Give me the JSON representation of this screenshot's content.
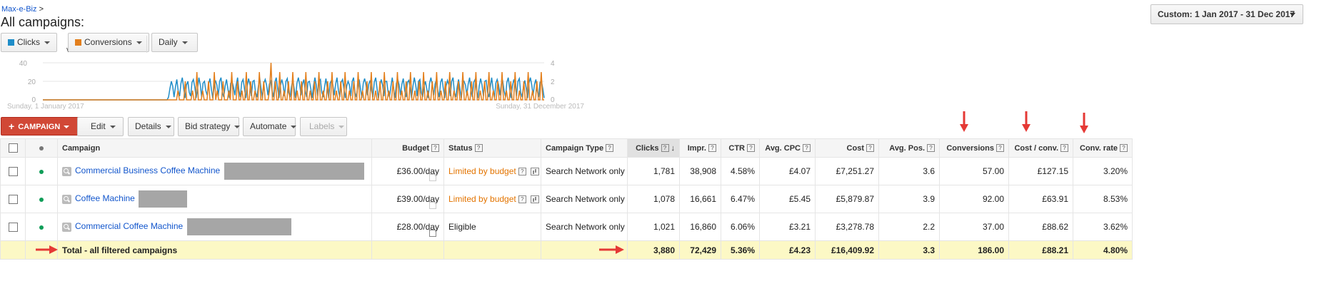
{
  "breadcrumb": {
    "account": "Max-e-Biz",
    "separator": ">"
  },
  "page_title": "All campaigns:",
  "date_range": "Custom: 1 Jan 2017 - 31 Dec 2017",
  "chart_controls": {
    "metric1": {
      "label": "Clicks",
      "color": "#1f8dc8"
    },
    "vs": "vs",
    "metric2": {
      "label": "Conversions",
      "color": "#e37f1c"
    },
    "granularity": "Daily"
  },
  "chart_data": {
    "type": "line",
    "x_start_label": "Sunday, 1 January 2017",
    "x_end_label": "Sunday, 31 December 2017",
    "left_axis": {
      "ticks": [
        "40",
        "20",
        "0"
      ],
      "ylim": [
        0,
        40
      ]
    },
    "right_axis": {
      "ticks": [
        "4",
        "2",
        "0"
      ],
      "ylim": [
        0,
        4
      ]
    },
    "series": [
      {
        "name": "Clicks",
        "color": "#1f8dc8",
        "values": [
          0,
          0,
          0,
          0,
          0,
          0,
          0,
          0,
          0,
          0,
          0,
          0,
          0,
          0,
          0,
          0,
          0,
          0,
          0,
          0,
          0,
          0,
          0,
          0,
          0,
          0,
          0,
          0,
          0,
          0,
          0,
          0,
          0,
          0,
          0,
          0,
          0,
          0,
          0,
          0,
          0,
          0,
          0,
          0,
          0,
          0,
          0,
          0,
          0,
          0,
          0,
          0,
          0,
          0,
          0,
          0,
          0,
          0,
          0,
          0,
          0,
          0,
          0,
          0,
          0,
          0,
          0,
          0,
          0,
          0,
          0,
          0,
          0,
          0,
          0,
          0,
          0,
          0,
          0,
          0,
          0,
          0,
          0,
          0,
          0,
          0,
          0,
          0,
          0,
          0,
          0,
          3,
          12,
          20,
          15,
          3,
          14,
          22,
          10,
          4,
          18,
          24,
          12,
          2,
          16,
          20,
          8,
          4,
          19,
          22,
          14,
          2,
          12,
          24,
          16,
          3,
          18,
          20,
          10,
          5,
          17,
          23,
          12,
          2,
          14,
          21,
          16,
          4,
          20,
          24,
          8,
          3,
          15,
          22,
          12,
          2,
          18,
          20,
          14,
          5,
          16,
          24,
          10,
          3,
          19,
          22,
          12,
          2,
          15,
          23,
          16,
          4,
          20,
          21,
          8,
          3,
          14,
          24,
          12,
          2,
          18,
          22,
          16,
          5,
          17,
          20,
          10,
          3,
          19,
          24,
          12,
          2,
          15,
          22,
          16,
          4,
          20,
          23,
          8,
          3,
          14,
          21,
          12,
          2,
          18,
          24,
          16,
          5,
          17,
          22,
          10,
          3,
          19,
          20,
          12,
          2,
          15,
          24,
          16,
          4,
          20,
          22,
          8,
          3,
          14,
          23,
          12,
          2,
          18,
          21,
          16,
          5,
          17,
          24,
          10,
          3,
          19,
          22,
          12,
          2,
          15,
          20,
          16,
          4,
          20,
          24,
          8,
          3,
          14,
          22,
          12,
          2,
          18,
          23,
          16,
          5,
          17,
          21,
          10,
          3,
          19,
          24,
          12,
          2,
          15,
          22,
          16,
          4,
          20,
          20,
          8,
          3,
          14,
          24,
          12,
          2,
          18,
          22,
          16,
          5,
          17,
          23,
          10,
          3,
          19,
          21,
          12,
          2,
          15,
          24,
          16,
          4,
          20,
          22,
          8,
          3,
          14,
          20,
          12,
          2,
          18,
          24,
          16,
          5,
          17,
          22,
          10,
          3,
          19,
          23,
          12,
          2,
          15,
          21,
          16,
          4,
          20,
          24,
          8,
          3,
          14,
          22,
          12,
          2,
          18,
          20,
          16,
          5,
          17,
          24,
          10,
          3,
          19,
          22,
          12,
          2,
          15,
          23,
          16,
          4,
          20,
          21,
          8,
          3,
          14,
          24,
          12,
          2,
          18,
          22,
          16,
          5,
          17,
          20,
          10,
          3,
          19,
          24,
          12,
          2,
          15,
          22,
          16,
          4,
          20,
          23,
          8,
          3,
          14,
          21,
          12,
          2,
          18,
          24,
          16,
          5,
          17,
          22,
          10,
          3,
          19,
          20,
          12,
          2
        ]
      },
      {
        "name": "Conversions",
        "color": "#e37f1c",
        "values": [
          0,
          0,
          0,
          0,
          0,
          0,
          0,
          0,
          0,
          0,
          0,
          0,
          0,
          0,
          0,
          0,
          0,
          0,
          0,
          0,
          0,
          0,
          0,
          0,
          0,
          0,
          0,
          0,
          0,
          0,
          0,
          0,
          0,
          0,
          0,
          0,
          0,
          0,
          0,
          0,
          0,
          0,
          0,
          0,
          0,
          0,
          0,
          0,
          0,
          0,
          0,
          0,
          0,
          0,
          0,
          0,
          0,
          0,
          0,
          0,
          0,
          0,
          0,
          0,
          0,
          0,
          0,
          0,
          0,
          0,
          0,
          0,
          0,
          0,
          0,
          0,
          0,
          0,
          0,
          0,
          0,
          0,
          0,
          0,
          0,
          0,
          0,
          0,
          0,
          0,
          0,
          0,
          0,
          1,
          0,
          0,
          0,
          0,
          2,
          0,
          0,
          0,
          0,
          1,
          0,
          0,
          3,
          0,
          0,
          0,
          1,
          0,
          0,
          0,
          2,
          0,
          0,
          0,
          3,
          0,
          1,
          0,
          0,
          0,
          2,
          0,
          0,
          0,
          1,
          0,
          3,
          0,
          0,
          0,
          2,
          0,
          0,
          1,
          0,
          0,
          3,
          0,
          0,
          2,
          0,
          0,
          1,
          0,
          0,
          3,
          0,
          0,
          2,
          0,
          0,
          0,
          1,
          4,
          0,
          0,
          2,
          0,
          0,
          3,
          0,
          0,
          1,
          0,
          0,
          2,
          0,
          0,
          3,
          0,
          0,
          1,
          0,
          0,
          2,
          0,
          0,
          3,
          0,
          0,
          1,
          0,
          0,
          2,
          0,
          0,
          3,
          0,
          0,
          1,
          0,
          0,
          2,
          0,
          0,
          3,
          0,
          0,
          1,
          0,
          0,
          2,
          0,
          0,
          3,
          0,
          0,
          1,
          0,
          0,
          2,
          0,
          0,
          3,
          0,
          0,
          1,
          0,
          0,
          2,
          0,
          0,
          3,
          0,
          0,
          1,
          0,
          0,
          2,
          0,
          0,
          3,
          0,
          0,
          1,
          0,
          0,
          2,
          0,
          0,
          3,
          0,
          0,
          1,
          0,
          0,
          2,
          0,
          0,
          3,
          0,
          0,
          1,
          0,
          0,
          2,
          0,
          0,
          3,
          0,
          0,
          1,
          0,
          0,
          2,
          0,
          0,
          3,
          0,
          0,
          1,
          0,
          0,
          2,
          0,
          0,
          3,
          0,
          0,
          1,
          0,
          0,
          2,
          0,
          0,
          3,
          0,
          0,
          1,
          0,
          0,
          2,
          0,
          0,
          3,
          0,
          0,
          1,
          0,
          0,
          2,
          0,
          0,
          3,
          0,
          0,
          1,
          0,
          0,
          2,
          0,
          0,
          3,
          0,
          0,
          1,
          0,
          0,
          2,
          0,
          0,
          3,
          0,
          0,
          1,
          0,
          0,
          2,
          0,
          0,
          3,
          0,
          0,
          1,
          0,
          0,
          2,
          0,
          0,
          3,
          0,
          0
        ]
      }
    ]
  },
  "toolbar": {
    "campaign_label": "CAMPAIGN",
    "edit": "Edit",
    "details": "Details",
    "bid_strategy": "Bid strategy",
    "automate": "Automate",
    "labels": "Labels"
  },
  "table": {
    "headers": {
      "campaign": "Campaign",
      "budget": "Budget",
      "status": "Status",
      "campaign_type": "Campaign Type",
      "clicks": "Clicks",
      "impr": "Impr.",
      "ctr": "CTR",
      "avg_cpc": "Avg. CPC",
      "cost": "Cost",
      "avg_pos": "Avg. Pos.",
      "conversions": "Conversions",
      "cost_conv": "Cost / conv.",
      "conv_rate": "Conv. rate",
      "help": "?"
    },
    "rows": [
      {
        "campaign": "Commercial Business Coffee Machine",
        "budget": "£36.00/day",
        "status": "Limited by budget",
        "status_limited": true,
        "type": "Search Network only",
        "clicks": "1,781",
        "impr": "38,908",
        "ctr": "4.58%",
        "avg_cpc": "£4.07",
        "cost": "£7,251.27",
        "avg_pos": "3.6",
        "conversions": "57.00",
        "cost_conv": "£127.15",
        "conv_rate": "3.20%"
      },
      {
        "campaign": "Coffee Machine",
        "budget": "£39.00/day",
        "status": "Limited by budget",
        "status_limited": true,
        "type": "Search Network only",
        "clicks": "1,078",
        "impr": "16,661",
        "ctr": "6.47%",
        "avg_cpc": "£5.45",
        "cost": "£5,879.87",
        "avg_pos": "3.9",
        "conversions": "92.00",
        "cost_conv": "£63.91",
        "conv_rate": "8.53%"
      },
      {
        "campaign": "Commercial Coffee Machine",
        "budget": "£28.00/day",
        "status": "Eligible",
        "status_limited": false,
        "type": "Search Network only",
        "clicks": "1,021",
        "impr": "16,860",
        "ctr": "6.06%",
        "avg_cpc": "£3.21",
        "cost": "£3,278.78",
        "avg_pos": "2.2",
        "conversions": "37.00",
        "cost_conv": "£88.62",
        "conv_rate": "3.62%"
      }
    ],
    "total": {
      "label": "Total - all filtered campaigns",
      "clicks": "3,880",
      "impr": "72,429",
      "ctr": "5.36%",
      "avg_cpc": "£4.23",
      "cost": "£16,409.92",
      "avg_pos": "3.3",
      "conversions": "186.00",
      "cost_conv": "£88.21",
      "conv_rate": "4.80%"
    }
  },
  "annotation_color": "#e53935"
}
